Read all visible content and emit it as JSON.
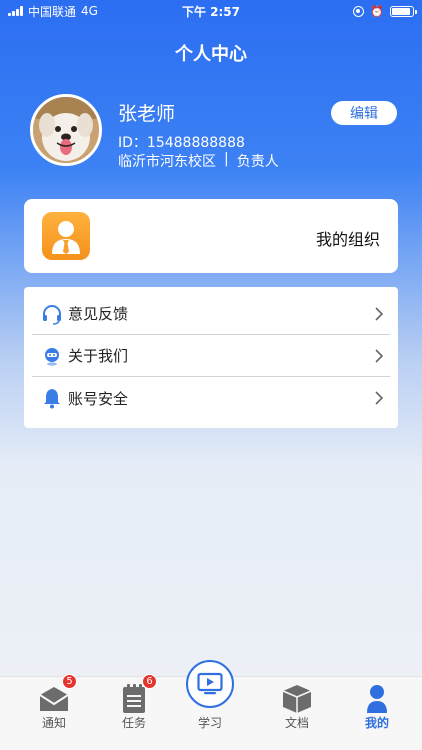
{
  "status_bar": {
    "carrier": "中国联通",
    "network": "4G",
    "time": "下午 2:57",
    "battery_level": 0.9
  },
  "header": {
    "title": "个人中心"
  },
  "profile": {
    "name": "张老师",
    "id_text": "ID：15488888888",
    "campus": "临沂市河东校区",
    "separator": "|",
    "role": "负责人",
    "edit_label": "编辑"
  },
  "org_card": {
    "label": "我的组织",
    "icon": "manager-icon",
    "icon_color": "#f7a02c"
  },
  "menu": {
    "items": [
      {
        "label": "意见反馈",
        "icon": "headset-icon"
      },
      {
        "label": "关于我们",
        "icon": "robot-icon"
      },
      {
        "label": "账号安全",
        "icon": "bell-icon"
      }
    ]
  },
  "tab_bar": {
    "tabs": [
      {
        "label": "通知",
        "icon": "envelope-icon",
        "badge": "5"
      },
      {
        "label": "任务",
        "icon": "task-list-icon",
        "badge": "6"
      },
      {
        "label": "学习",
        "icon": "video-play-icon"
      },
      {
        "label": "文档",
        "icon": "box-icon"
      },
      {
        "label": "我的",
        "icon": "person-icon",
        "active": true
      }
    ]
  },
  "colors": {
    "accent": "#2f6fe0",
    "header_gradient_top": "#2c6ef2",
    "badge": "#e5342b",
    "org_icon": "#f7a02c"
  }
}
